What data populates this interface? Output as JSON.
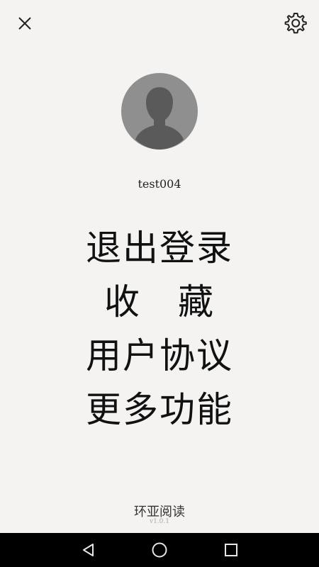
{
  "header": {
    "close_icon": "close-icon",
    "settings_icon": "gear-icon"
  },
  "profile": {
    "avatar_icon": "default-avatar-icon",
    "username": "test004"
  },
  "menu": {
    "items": [
      {
        "label": "退出登录"
      },
      {
        "label": "收　藏"
      },
      {
        "label": "用户协议"
      },
      {
        "label": "更多功能"
      }
    ]
  },
  "footer": {
    "app_name": "环亚阅读",
    "version": "v1.0.1"
  },
  "nav_bar": {
    "back_icon": "back-triangle-icon",
    "home_icon": "home-circle-icon",
    "recents_icon": "recents-square-icon"
  },
  "colors": {
    "background": "#f4f3f2",
    "avatar_bg": "#8f8f8f",
    "avatar_figure": "#5a5a5a",
    "nav_bar": "#000000"
  }
}
